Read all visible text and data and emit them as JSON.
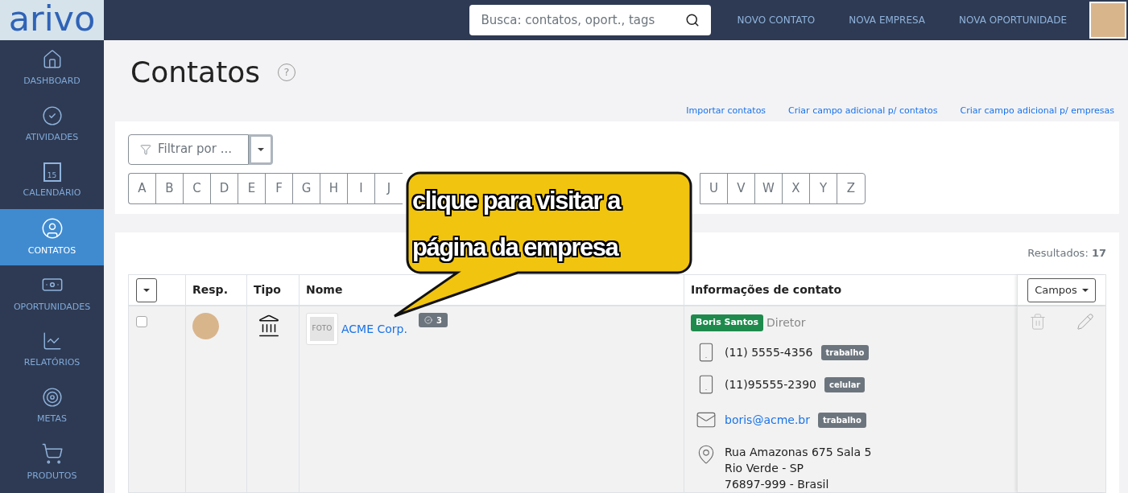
{
  "logo": "arivo",
  "search": {
    "placeholder": "Busca: contatos, oport., tags"
  },
  "top_links": [
    "NOVO CONTATO",
    "NOVA EMPRESA",
    "NOVA OPORTUNIDADE"
  ],
  "sidebar": {
    "items": [
      {
        "label": "DASHBOARD",
        "selected": false
      },
      {
        "label": "ATIVIDADES",
        "selected": false
      },
      {
        "label": "CALENDÁRIO",
        "selected": false,
        "day": "15"
      },
      {
        "label": "CONTATOS",
        "selected": true
      },
      {
        "label": "OPORTUNIDADES",
        "selected": false
      },
      {
        "label": "RELATÓRIOS",
        "selected": false
      },
      {
        "label": "METAS",
        "selected": false
      },
      {
        "label": "PRODUTOS",
        "selected": false
      }
    ]
  },
  "page": {
    "title": "Contatos",
    "help": "?",
    "links": [
      "Importar contatos",
      "Criar campo adicional p/ contatos",
      "Criar campo adicional p/ empresas"
    ]
  },
  "filter": {
    "label": "Filtrar por ..."
  },
  "alphabet": {
    "left": [
      "A",
      "B",
      "C",
      "D",
      "E",
      "F",
      "G",
      "H",
      "I",
      "J"
    ],
    "right": [
      "U",
      "V",
      "W",
      "X",
      "Y",
      "Z"
    ]
  },
  "results": "Resultados: **17**",
  "table": {
    "columns": [
      "Resp.",
      "Tipo",
      "Nome",
      "Informações de contato"
    ],
    "fields_button": "Campos",
    "rows": [
      {
        "checked": false,
        "photo_label": "FOTO",
        "name": "ACME Corp.",
        "badge": "3",
        "contact": {
          "name": "Boris Santos",
          "role": "Diretor",
          "items": [
            {
              "kind": "phone",
              "value": "(11) 5555-4356",
              "tag": "trabalho"
            },
            {
              "kind": "phone",
              "value": "(11)95555-2390",
              "tag": "celular"
            },
            {
              "kind": "email",
              "value": "boris@acme.br",
              "tag": "trabalho"
            },
            {
              "kind": "address",
              "lines": [
                "Rua Amazonas 675 Sala 5",
                "Rio Verde - SP",
                "76897-999 - Brasil"
              ]
            }
          ]
        }
      }
    ]
  },
  "callout": {
    "text": "clique para visitar a página da empresa"
  }
}
